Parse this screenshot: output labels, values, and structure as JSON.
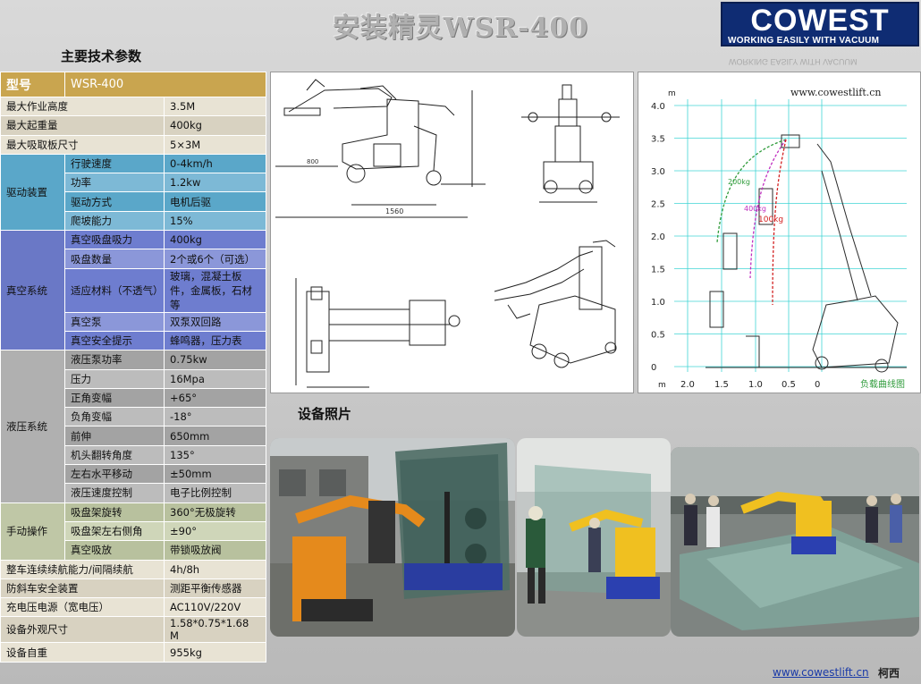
{
  "title": "安装精灵WSR-400",
  "logo": {
    "main": "COWEST",
    "tagline": "WORKING EASILY WITH VACUUM",
    "reflection": "WORKING EASILY WITH VACUUM"
  },
  "specs_heading": "主要技术参数",
  "photos_heading": "设备照片",
  "spec_table": {
    "header": {
      "label": "型号",
      "value": "WSR-400"
    },
    "top_rows": [
      {
        "label": "最大作业高度",
        "value": "3.5M"
      },
      {
        "label": "最大起重量",
        "value": "400kg"
      },
      {
        "label": "最大吸取板尺寸",
        "value": "5×3M"
      }
    ],
    "groups": [
      {
        "name": "驱动装置",
        "rows": [
          {
            "label": "行驶速度",
            "value": "0-4km/h"
          },
          {
            "label": "功率",
            "value": "1.2kw"
          },
          {
            "label": "驱动方式",
            "value": "电机后驱"
          },
          {
            "label": "爬坡能力",
            "value": "15%"
          }
        ]
      },
      {
        "name": "真空系统",
        "rows": [
          {
            "label": "真空吸盘吸力",
            "value": "400kg"
          },
          {
            "label": "吸盘数量",
            "value": "2个或6个（可选）"
          },
          {
            "label": "适应材料（不透气）",
            "value": "玻璃，混凝土板件，金属板，石材等"
          },
          {
            "label": "真空泵",
            "value": "双泵双回路"
          },
          {
            "label": "真空安全提示",
            "value": "蜂鸣器，压力表"
          }
        ]
      },
      {
        "name": "液压系统",
        "rows": [
          {
            "label": "液压泵功率",
            "value": "0.75kw"
          },
          {
            "label": "压力",
            "value": "16Mpa"
          },
          {
            "label": "正角变幅",
            "value": "+65°"
          },
          {
            "label": "负角变幅",
            "value": "-18°"
          },
          {
            "label": "前伸",
            "value": "650mm"
          },
          {
            "label": "机头翻转角度",
            "value": "135°"
          },
          {
            "label": "左右水平移动",
            "value": "±50mm"
          },
          {
            "label": "液压速度控制",
            "value": "电子比例控制"
          }
        ]
      },
      {
        "name": "手动操作",
        "rows": [
          {
            "label": "吸盘架旋转",
            "value": "360°无极旋转"
          },
          {
            "label": "吸盘架左右侧角",
            "value": "±90°"
          },
          {
            "label": "真空吸放",
            "value": "带锁吸放阀"
          }
        ]
      }
    ],
    "bottom_rows": [
      {
        "label": "整车连续续航能力/间隔续航",
        "value": "4h/8h"
      },
      {
        "label": "防斜车安全装置",
        "value": "测距平衡传感器"
      },
      {
        "label": "充电压电源（宽电压）",
        "value": "AC110V/220V"
      },
      {
        "label": "设备外观尺寸",
        "value": "1.58*0.75*1.68 M"
      },
      {
        "label": "设备自重",
        "value": "955kg"
      }
    ]
  },
  "drawings": {
    "dim_1560": "1560",
    "dim_800": "800"
  },
  "load_chart": {
    "url": "www.cowestlift.cn",
    "y_unit": "m",
    "x_unit": "m",
    "y_ticks": [
      "4.0",
      "3.5",
      "3.0",
      "2.5",
      "2.0",
      "1.5",
      "1.0",
      "0.5",
      "0"
    ],
    "x_ticks": [
      "2.0",
      "1.5",
      "1.0",
      "0.5",
      "0"
    ],
    "curves": [
      "200kg",
      "400kg",
      "100kg"
    ],
    "caption": "负载曲线图"
  },
  "footer": {
    "url": "www.cowestlift.cn",
    "brand": "柯西"
  },
  "colors": {
    "header_gold": "#c9a54f",
    "drive_blue": "#5aa7c9",
    "vacuum_purple": "#6e7dcf",
    "hydraulic_gray": "#a3a3a3",
    "manual_olive": "#b8c19e",
    "logo_navy": "#0f2c73"
  }
}
